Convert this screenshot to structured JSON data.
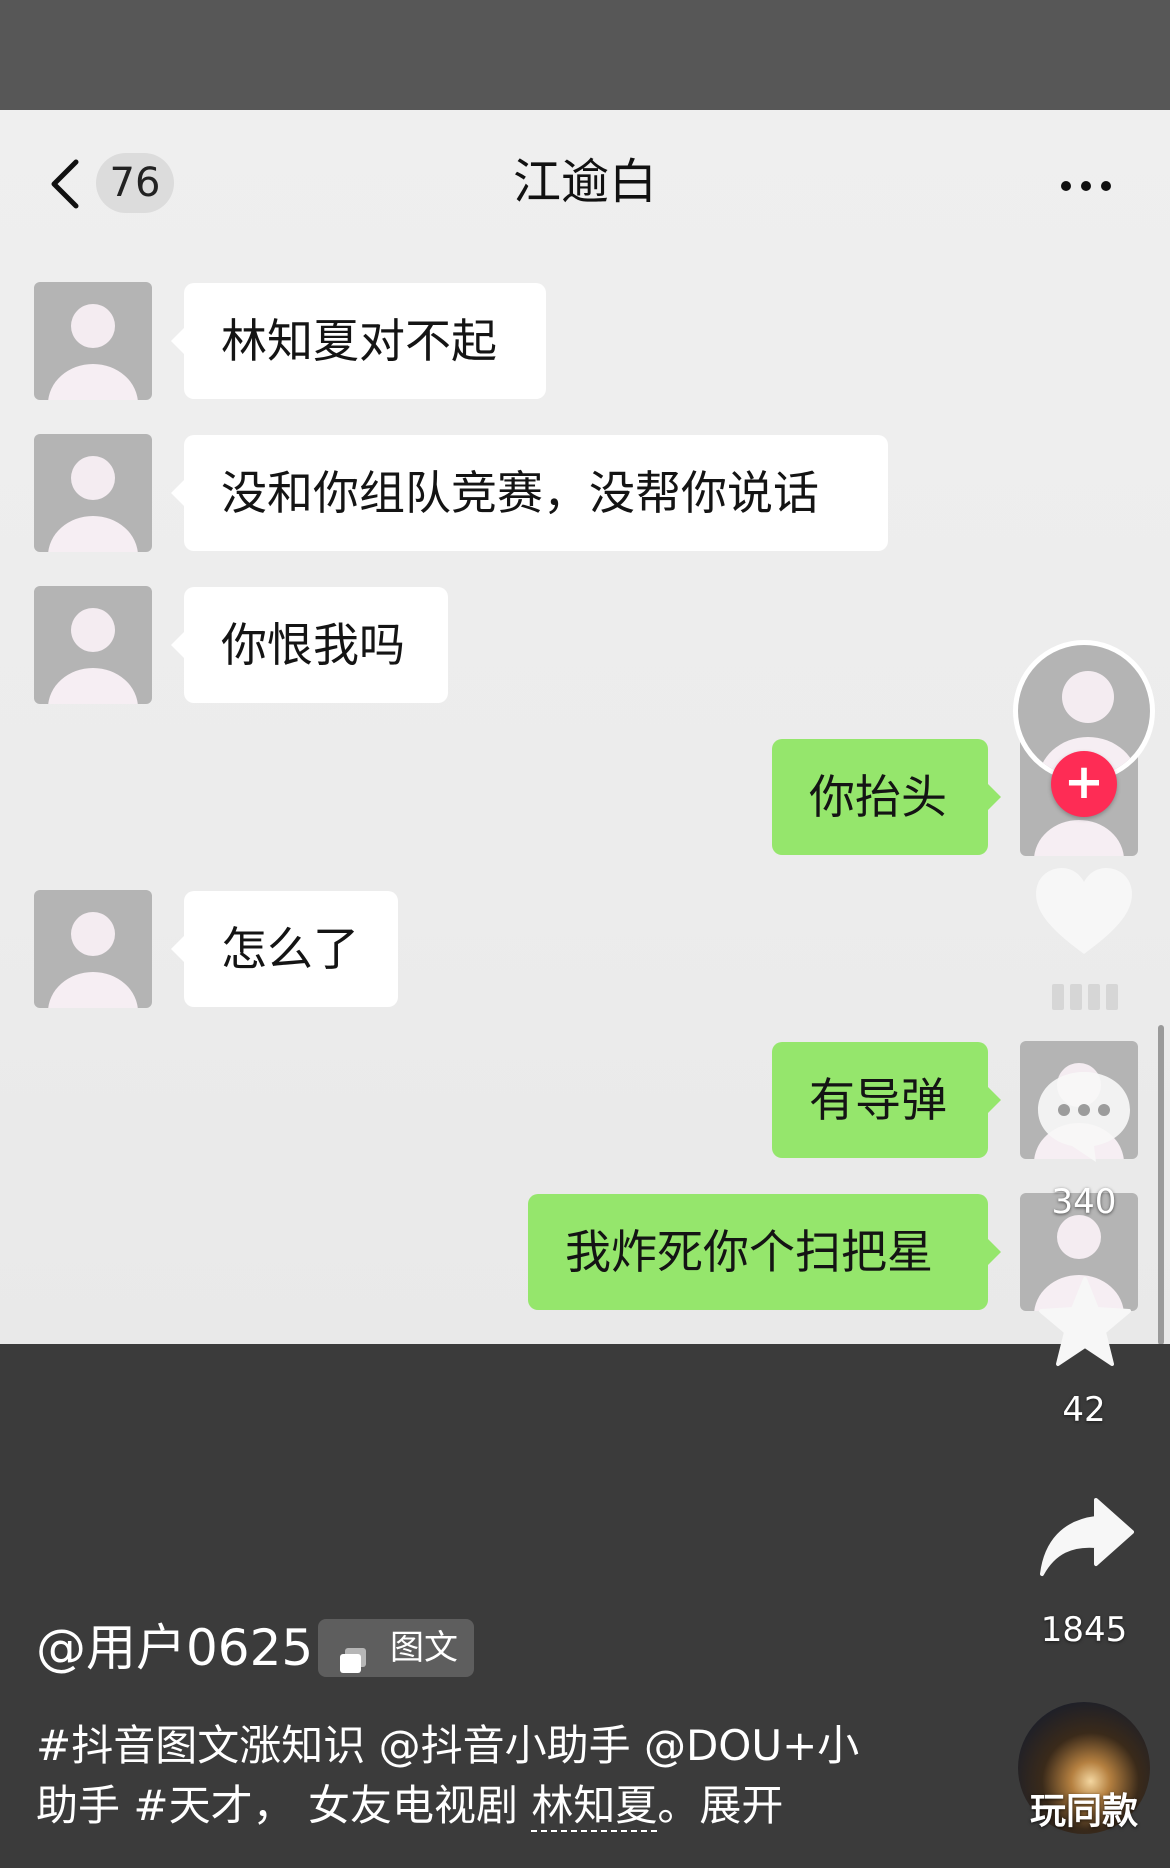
{
  "chat": {
    "back_count": "76",
    "title": "江逾白",
    "messages": [
      {
        "side": "left",
        "text": "林知夏对不起"
      },
      {
        "side": "left",
        "text": "没和你组队竞赛，没帮你说话"
      },
      {
        "side": "left",
        "text": "你恨我吗"
      },
      {
        "side": "right",
        "text": "你抬头"
      },
      {
        "side": "left",
        "text": "怎么了"
      },
      {
        "side": "right",
        "text": "有导弹"
      },
      {
        "side": "right",
        "text": "我炸死你个扫把星"
      }
    ]
  },
  "rail": {
    "follow_symbol": "+",
    "comment_count": "340",
    "favorite_count": "42",
    "share_count": "1845",
    "remix_label": "玩同款"
  },
  "post": {
    "author": "@用户0625",
    "type_badge": "图文",
    "caption": {
      "tag1": "#抖音图文涨知识",
      "mention1": "@抖音小助手",
      "mention2_a": "@DOU+小",
      "mention2_b": "助手",
      "tag2": "#天才，",
      "text": "女友电视剧",
      "keyword": "林知夏",
      "dot": "。",
      "expand": "展开"
    }
  },
  "icons": {
    "back": "chevron-left-icon",
    "more": "more-dots-icon",
    "like": "heart-icon",
    "comment": "comment-bubble-icon",
    "favorite": "star-icon",
    "share": "share-arrow-icon"
  },
  "colors": {
    "accent_follow": "#fe2c55",
    "sent_bubble": "#95e66c",
    "received_bubble": "#ffffff"
  }
}
